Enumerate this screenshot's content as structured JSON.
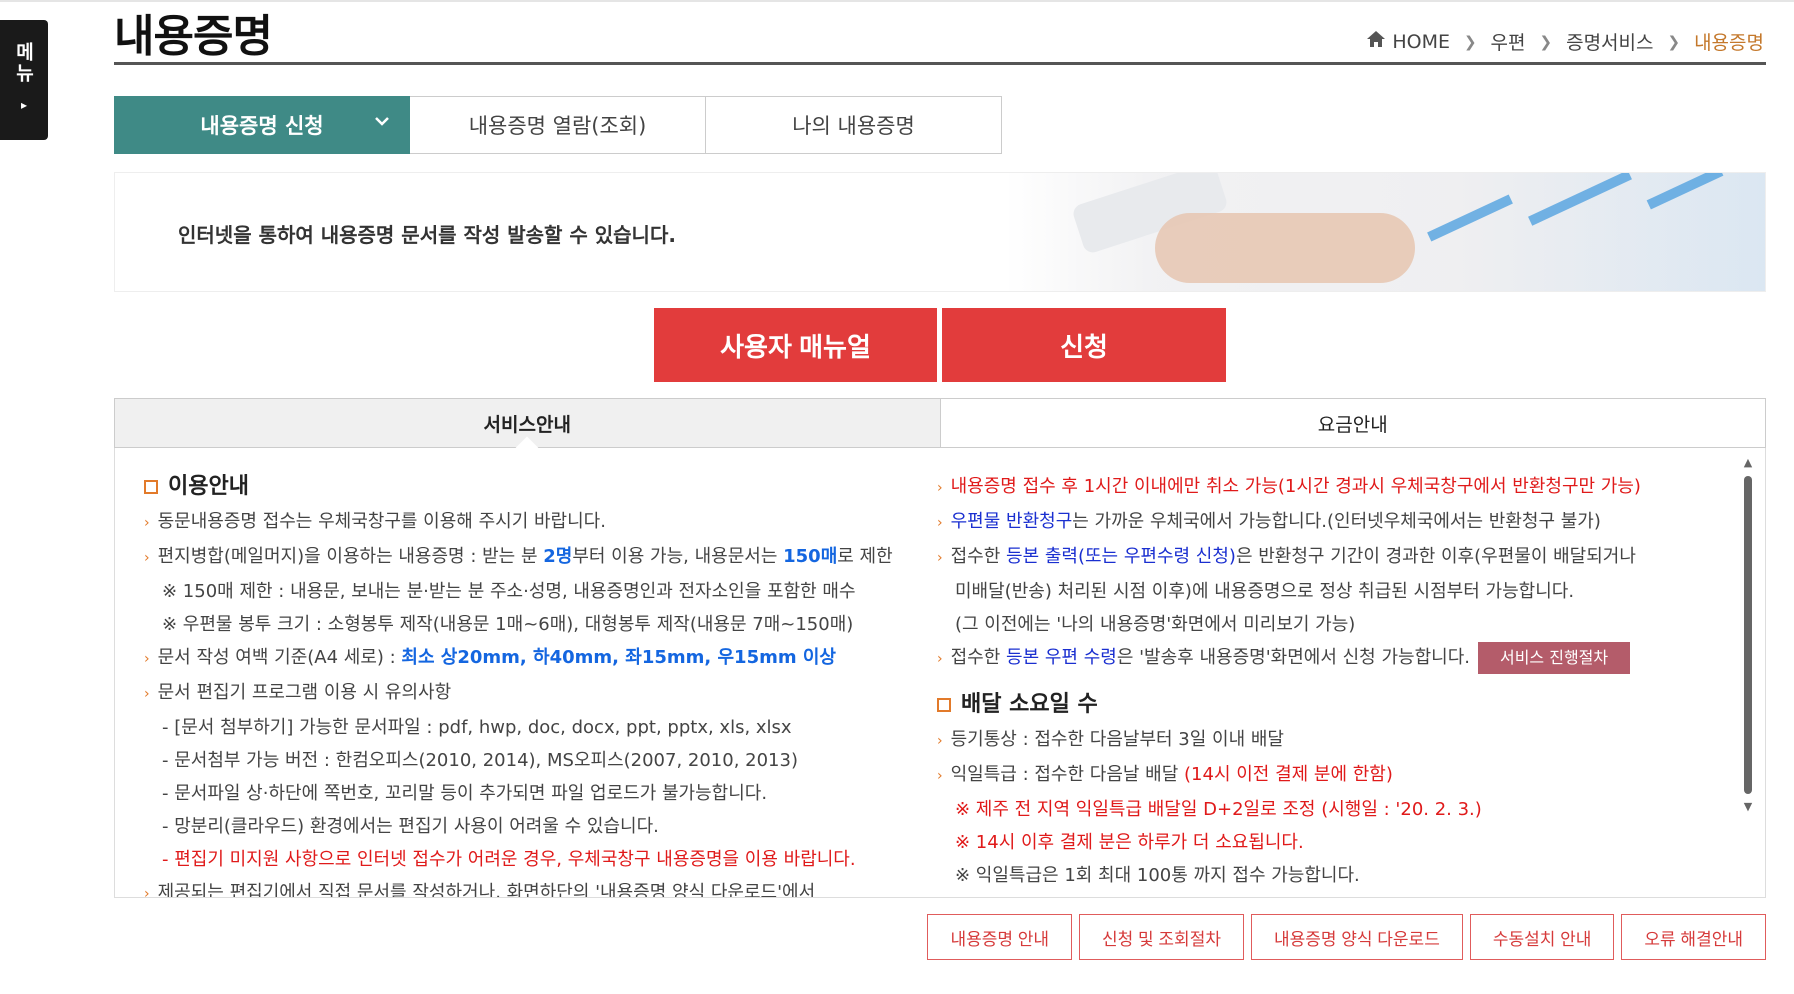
{
  "side_menu": {
    "label": "메뉴",
    "arrow": "▸"
  },
  "page_title": "내용증명",
  "breadcrumb": [
    "HOME",
    "우편",
    "증명서비스",
    "내용증명"
  ],
  "tabs": [
    "내용증명 신청",
    "내용증명 열람(조회)",
    "나의 내용증명"
  ],
  "banner": {
    "description": "인터넷을 통하여 내용증명 문서를 작성 발송할 수 있습니다."
  },
  "buttons": {
    "manual": "사용자 매뉴얼",
    "apply": "신청"
  },
  "info_tabs": [
    "서비스안내",
    "요금안내"
  ],
  "left": {
    "heading": "이용안내",
    "l1": "동문내용증명 접수는 우체국창구를 이용해 주시기 바랍니다.",
    "l2a": "편지병합(메일머지)을 이용하는 내용증명 : 받는 분 ",
    "l2b": "2명",
    "l2c": "부터 이용 가능, 내용문서는 ",
    "l2d": "150매",
    "l2e": "로 제한",
    "l3": "※ 150매 제한 : 내용문, 보내는 분·받는 분 주소·성명, 내용증명인과 전자소인을 포함한 매수",
    "l4": "※ 우편물 봉투 크기 : 소형봉투 제작(내용문 1매~6매), 대형봉투 제작(내용문 7매~150매)",
    "l5a": "문서 작성 여백 기준(A4 세로) : ",
    "l5b": "최소 상20mm, 하40mm, 좌15mm, 우15mm 이상",
    "l6": "문서 편집기 프로그램 이용 시 유의사항",
    "l7": "- [문서 첨부하기] 가능한 문서파일 : pdf, hwp, doc, docx, ppt, pptx, xls, xlsx",
    "l8": "- 문서첨부 가능 버전 : 한컴오피스(2010, 2014), MS오피스(2007, 2010, 2013)",
    "l9": "- 문서파일 상·하단에 쪽번호, 꼬리말 등이 추가되면 파일 업로드가 불가능합니다.",
    "l10": "- 망분리(클라우드) 환경에서는 편집기 사용이 어려울 수 있습니다.",
    "l11": "- 편집기 미지원 사항으로 인터넷 접수가 어려운 경우, 우체국창구 내용증명을 이용 바랍니다.",
    "l12": "제공되는 편집기에서 직접 문서를 작성하거나, 화면하단의 '내용증명 양식 다운로드'에서"
  },
  "right": {
    "r1": "내용증명 접수 후 1시간 이내에만 취소 가능(1시간 경과시 우체국창구에서 반환청구만 가능)",
    "r2a": "우편물 반환청구",
    "r2b": "는 가까운 우체국에서 가능합니다.(인터넷우체국에서는 반환청구 불가)",
    "r3a": "접수한 ",
    "r3b": "등본 출력(또는 우편수령 신청)",
    "r3c": "은 반환청구 기간이 경과한 이후(우편물이 배달되거나",
    "r4": "미배달(반송) 처리된 시점 이후)에 내용증명으로 정상 취급된 시점부터 가능합니다.",
    "r5": "(그 이전에는 '나의 내용증명'화면에서 미리보기 가능)",
    "r6a": "접수한 ",
    "r6b": "등본 우편 수령",
    "r6c": "은 '발송후 내용증명'화면에서 신청 가능합니다.",
    "r6btn": "서비스 진행절차",
    "heading2": "배달 소요일 수",
    "r7": "등기통상 : 접수한 다음날부터 3일 이내 배달",
    "r8a": "익일특급 : 접수한 다음날 배달 ",
    "r8b": "(14시 이전 결제 분에 한함)",
    "r9": "※ 제주 전 지역 익일특급 배달일 D+2일로 조정 (시행일 : '20. 2. 3.)",
    "r10": "※ 14시 이후 결제 분은 하루가 더 소요됩니다.",
    "r11": "※ 익일특급은 1회 최대 100통 까지 접수 가능합니다."
  },
  "bottom_buttons": [
    "내용증명 안내",
    "신청 및 조회절차",
    "내용증명 양식 다운로드",
    "수동설치 안내",
    "오류 해결안내"
  ],
  "colors": {
    "teal": "#3f8a86",
    "red": "#e23c3c",
    "orange": "#e27a2a",
    "blue": "#1466e0"
  }
}
